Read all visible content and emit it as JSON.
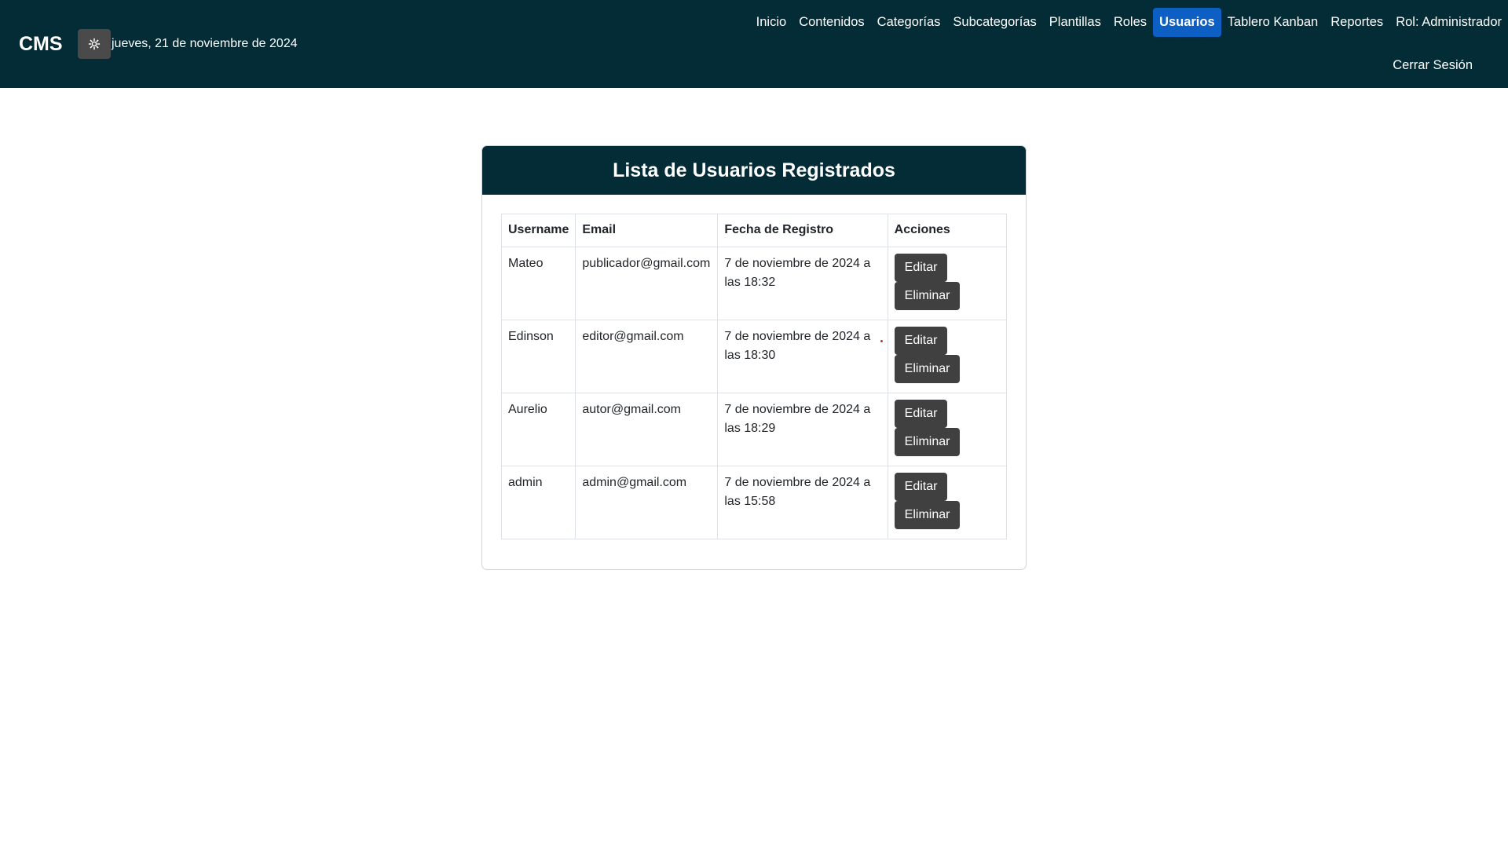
{
  "header": {
    "brand": "CMS",
    "theme_icon": "gear-icon",
    "date": "jueves, 21 de noviembre de 2024",
    "nav": [
      {
        "label": "Inicio"
      },
      {
        "label": "Contenidos"
      },
      {
        "label": "Categorías"
      },
      {
        "label": "Subcategorías"
      },
      {
        "label": "Plantillas"
      },
      {
        "label": "Roles"
      },
      {
        "label": "Usuarios",
        "active": true
      },
      {
        "label": "Tablero Kanban"
      },
      {
        "label": "Reportes"
      }
    ],
    "role": "Rol: Administrador",
    "logout": "Cerrar Sesión"
  },
  "colors": {
    "navbar": "#032c36",
    "active": "#0d5fc4",
    "button": "#404040"
  },
  "card": {
    "title": "Lista de Usuarios Registrados",
    "columns": [
      "Username",
      "Email",
      "Fecha de Registro",
      "Acciones"
    ],
    "rows": [
      {
        "username": "Mateo",
        "email": "publicador@gmail.com",
        "date": "7 de noviembre de 2024 a las 18:32"
      },
      {
        "username": "Edinson",
        "email": "editor@gmail.com",
        "date": "7 de noviembre de 2024 a las 18:30"
      },
      {
        "username": "Aurelio",
        "email": "autor@gmail.com",
        "date": "7 de noviembre de 2024 a las 18:29"
      },
      {
        "username": "admin",
        "email": "admin@gmail.com",
        "date": "7 de noviembre de 2024 a las 15:58"
      }
    ],
    "edit_label": "Editar",
    "delete_label": "Eliminar"
  }
}
